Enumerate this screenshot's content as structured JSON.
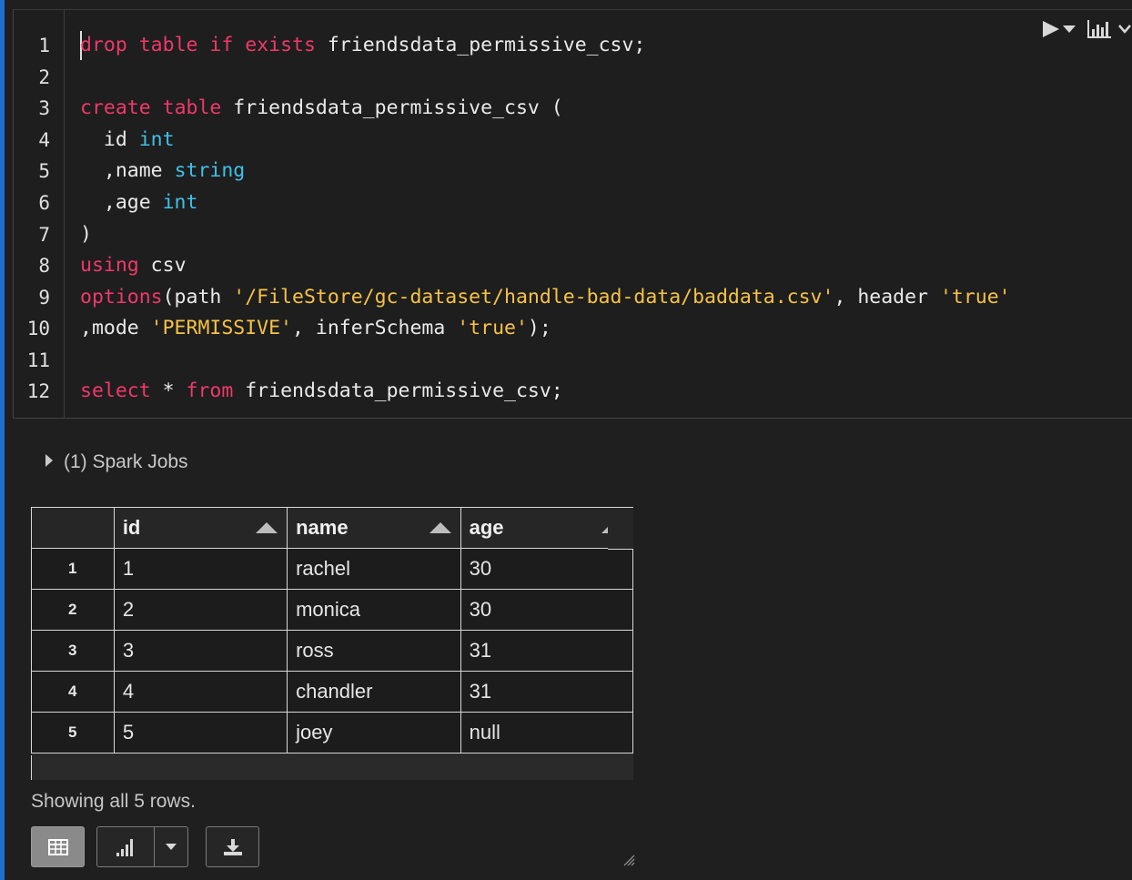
{
  "editor": {
    "line_numbers": [
      "1",
      "2",
      "3",
      "4",
      "5",
      "6",
      "7",
      "8",
      "9",
      "10",
      "11",
      "12"
    ]
  },
  "toolbar": {
    "run_icon": "play-icon",
    "run_menu_icon": "caret-down-icon",
    "chart_icon": "bar-chart-icon",
    "collapse_icon": "chevron-down-icon"
  },
  "jobs": {
    "label": "(1) Spark Jobs"
  },
  "table": {
    "columns": [
      "id",
      "name",
      "age"
    ],
    "rows": [
      {
        "index": "1",
        "id": "1",
        "name": "rachel",
        "age": "30"
      },
      {
        "index": "2",
        "id": "2",
        "name": "monica",
        "age": "30"
      },
      {
        "index": "3",
        "id": "3",
        "name": "ross",
        "age": "31"
      },
      {
        "index": "4",
        "id": "4",
        "name": "chandler",
        "age": "31"
      },
      {
        "index": "5",
        "id": "5",
        "name": "joey",
        "age": "null"
      }
    ]
  },
  "footer": {
    "showing": "Showing all 5 rows.",
    "table_view_icon": "table-icon",
    "chart_view_icon": "bar-chart-icon",
    "chart_menu_icon": "caret-down-icon",
    "download_icon": "download-icon"
  },
  "colors": {
    "keyword": "#f0386b",
    "type": "#3fc1e8",
    "string": "#f6c244",
    "accent": "#1f6fd0"
  }
}
